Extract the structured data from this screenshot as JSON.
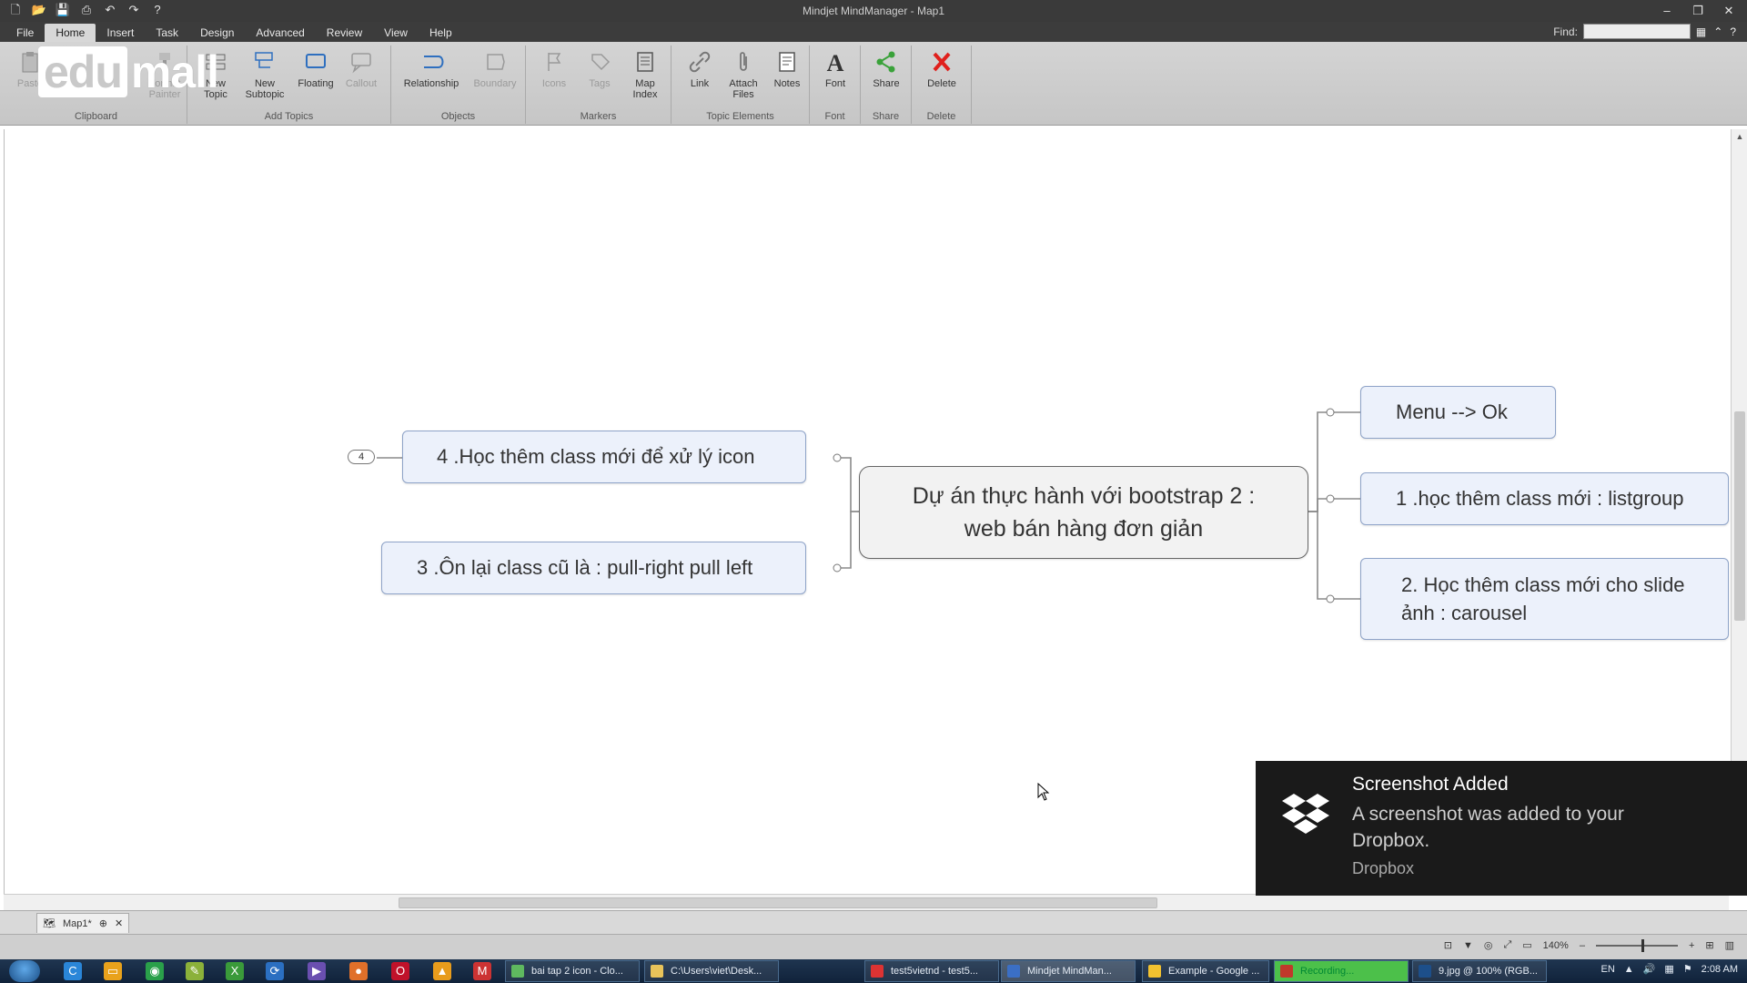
{
  "window": {
    "title": "Mindjet MindManager - Map1"
  },
  "menu": {
    "tabs": [
      "File",
      "Home",
      "Insert",
      "Task",
      "Design",
      "Advanced",
      "Review",
      "View",
      "Help"
    ],
    "active_tab": "Home",
    "find_label": "Find:"
  },
  "watermark": {
    "part1": "edu",
    "part2": "mall"
  },
  "ribbon": {
    "groups": {
      "clipboard": "Clipboard",
      "add_topics": "Add Topics",
      "objects": "Objects",
      "markers": "Markers",
      "topic_elements": "Topic Elements",
      "font": "Font",
      "share": "Share",
      "delete": "Delete"
    },
    "buttons": {
      "paste": "Paste",
      "format_painter": "Format Painter",
      "new_topic": "New Topic",
      "new_subtopic": "New Subtopic",
      "floating": "Floating",
      "callout": "Callout",
      "relationship": "Relationship",
      "boundary": "Boundary",
      "icons": "Icons",
      "tags": "Tags",
      "map_index": "Map Index",
      "link": "Link",
      "attach_files": "Attach Files",
      "notes": "Notes",
      "font": "Font",
      "share": "Share",
      "delete": "Delete"
    },
    "colors": {
      "delete": "#e0201c",
      "share": "#3aa23a",
      "relationship": "#2e6fbf"
    }
  },
  "mindmap": {
    "central": {
      "line1": "Dự án thực hành với bootstrap 2 :",
      "line2": "web bán hàng đơn giản"
    },
    "left_topics": [
      {
        "text": "4 .Học thêm class mới  để xử lý icon",
        "collapsed_count": "4"
      },
      {
        "text": "3 .Ôn lại class cũ là : pull-right pull left"
      }
    ],
    "right_topics": [
      {
        "text": "Menu --> Ok"
      },
      {
        "text": "1 .học thêm class mới : listgroup"
      },
      {
        "line1": "2. Học thêm class mới cho slide",
        "line2": "ảnh : carousel"
      }
    ]
  },
  "notification": {
    "icon": "dropbox-icon",
    "title": "Screenshot Added",
    "message": "A screenshot was added to your Dropbox.",
    "source": "Dropbox"
  },
  "document_tabs": [
    {
      "label": "Map1*"
    }
  ],
  "statusbar": {
    "zoom": "140%"
  },
  "taskbar": {
    "tasks": [
      {
        "label": "bai tap 2 icon - Clo...",
        "color": "#5fb85f"
      },
      {
        "label": "C:\\Users\\viet\\Desk...",
        "color": "#e8c35a"
      },
      {
        "label": "test5vietnd - test5...",
        "color": "#d33"
      },
      {
        "label": "Mindjet MindMan...",
        "color": "#3b6fc5",
        "active": true
      },
      {
        "label": "Example - Google ...",
        "color": "#f2c230"
      },
      {
        "label": "Recording...",
        "color": "#c0392b",
        "highlight": true
      },
      {
        "label": "9.jpg @ 100% (RGB...",
        "color": "#1d4f8a"
      }
    ],
    "lang": "EN",
    "time": "2:08 AM"
  }
}
